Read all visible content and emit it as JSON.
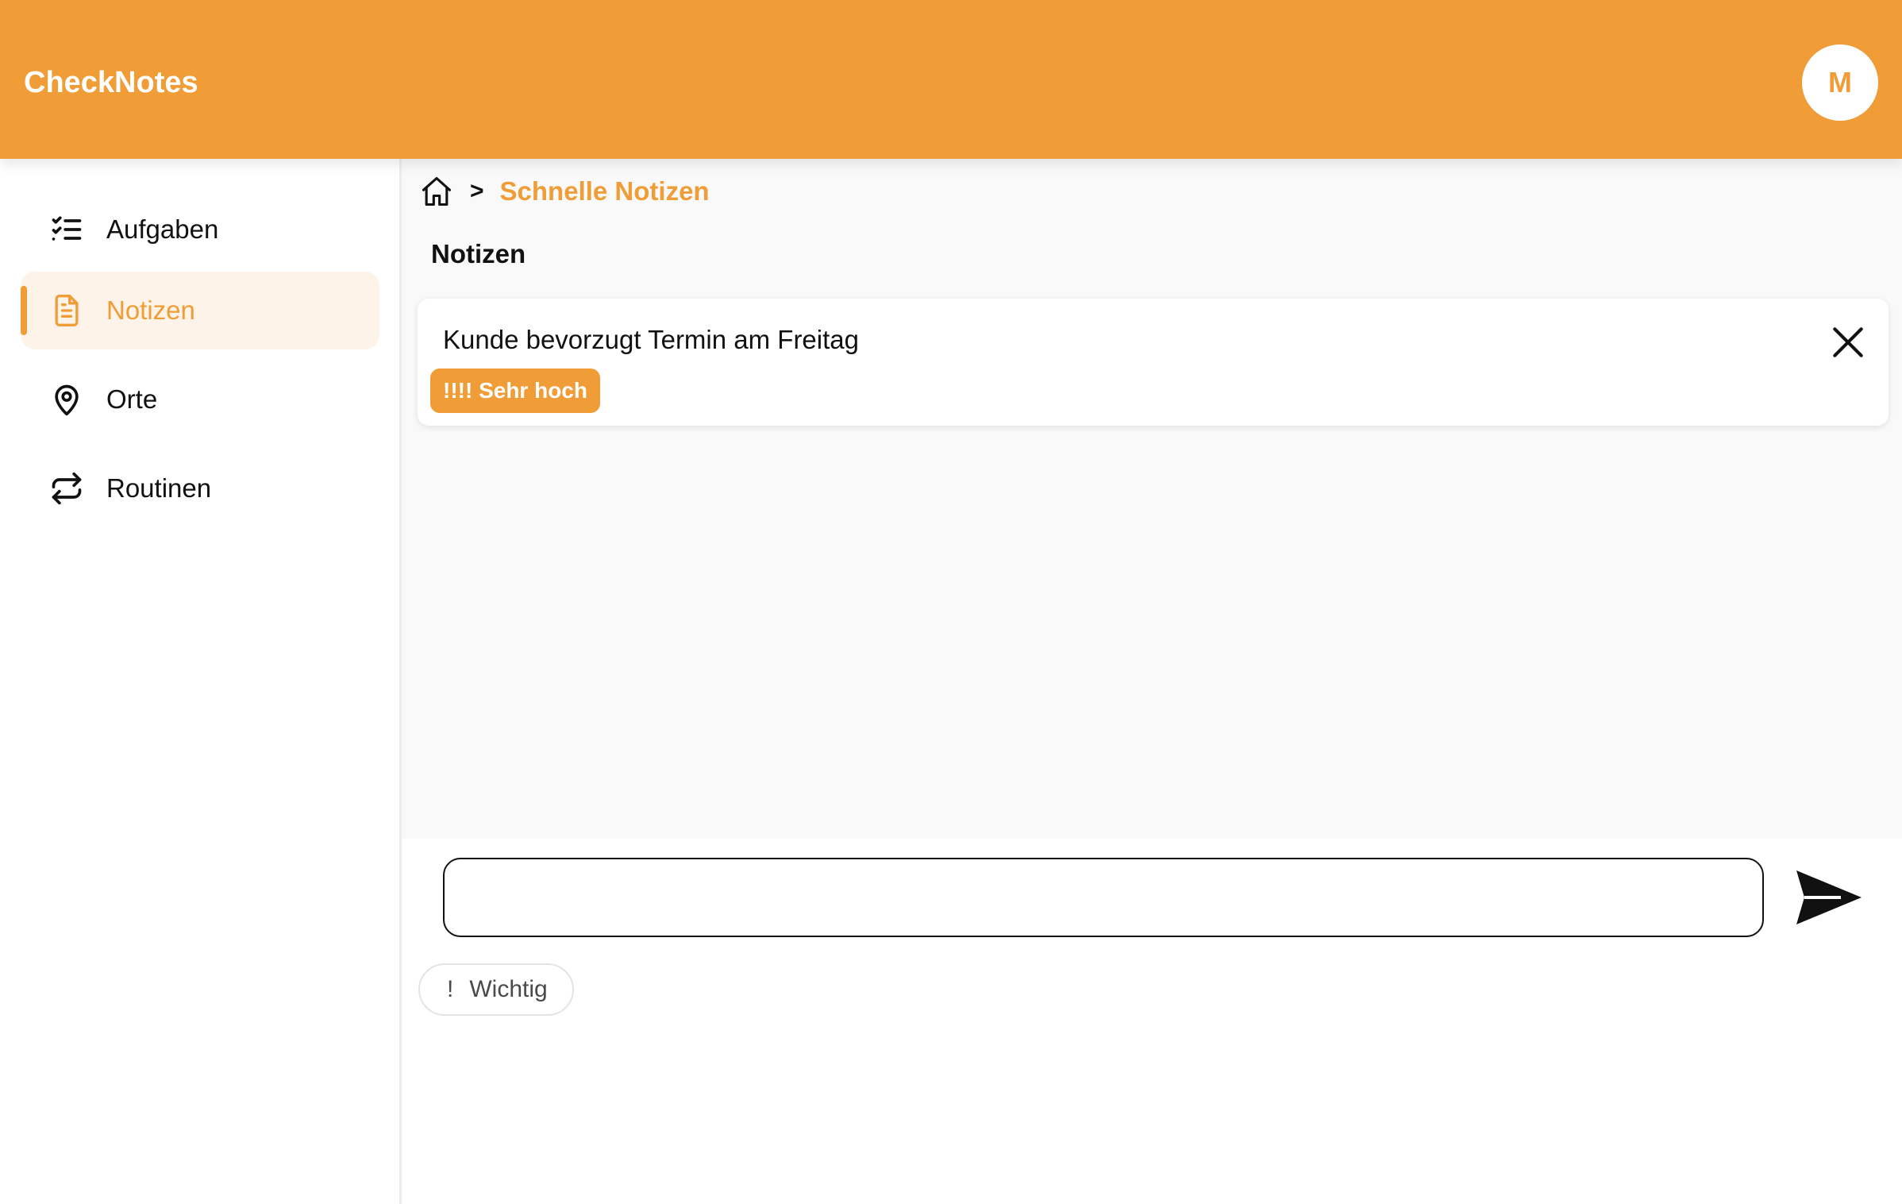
{
  "header": {
    "app_title": "CheckNotes",
    "avatar_initial": "M",
    "accent_color": "#f09d38"
  },
  "sidebar": {
    "items": [
      {
        "label": "Aufgaben",
        "icon": "checklist-icon",
        "active": false
      },
      {
        "label": "Notizen",
        "icon": "document-icon",
        "active": true
      },
      {
        "label": "Orte",
        "icon": "map-pin-icon",
        "active": false
      },
      {
        "label": "Routinen",
        "icon": "repeat-icon",
        "active": false
      }
    ]
  },
  "breadcrumb": {
    "home_icon": "home-icon",
    "separator": ">",
    "current": "Schnelle Notizen"
  },
  "main": {
    "section_title": "Notizen",
    "notes": [
      {
        "text": "Kunde bevorzugt Termin am Freitag",
        "priority": "!!!! Sehr hoch"
      }
    ]
  },
  "composer": {
    "input_value": "",
    "send_icon": "send-icon",
    "chips": [
      {
        "icon_glyph": "!",
        "label": "Wichtig"
      }
    ]
  }
}
